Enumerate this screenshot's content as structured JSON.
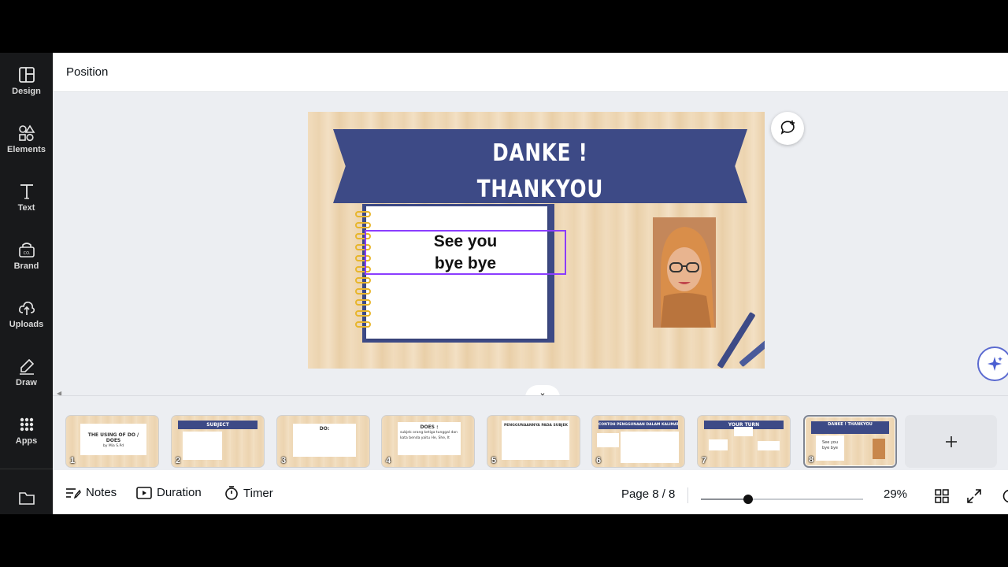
{
  "sidebar": {
    "items": [
      {
        "label": "Design",
        "icon": "layout-icon"
      },
      {
        "label": "Elements",
        "icon": "shapes-icon"
      },
      {
        "label": "Text",
        "icon": "text-icon"
      },
      {
        "label": "Brand",
        "icon": "brand-icon"
      },
      {
        "label": "Uploads",
        "icon": "upload-cloud-icon"
      },
      {
        "label": "Draw",
        "icon": "draw-icon"
      },
      {
        "label": "Apps",
        "icon": "apps-grid-icon"
      }
    ],
    "folder_icon": "folder-icon"
  },
  "topbar": {
    "title": "Position"
  },
  "slide": {
    "banner_line1": "DANKE !",
    "banner_line2": "THANKYOU",
    "text_line1": "See you",
    "text_line2": "bye bye"
  },
  "filmstrip": {
    "pages": [
      {
        "num": "1",
        "title": "THE USING OF DO / DOES",
        "body": "by Mia S.Pd"
      },
      {
        "num": "2",
        "title": "SUBJECT",
        "body": ""
      },
      {
        "num": "3",
        "title": "DO:",
        "body": ""
      },
      {
        "num": "4",
        "title": "DOES :",
        "body": "subjek orang ketiga tunggal dan kata benda yaitu He, She, It"
      },
      {
        "num": "5",
        "title": "PENGGUNAANNYA PADA SUBJEK",
        "body": ""
      },
      {
        "num": "6",
        "title": "CONTOH PENGGUNAAN DALAM KALIMAT",
        "body": ""
      },
      {
        "num": "7",
        "title": "YOUR TURN",
        "body": ""
      },
      {
        "num": "8",
        "title": "DANKE ! THANKYOU",
        "body": "See you bye bye"
      }
    ],
    "active_page": 8
  },
  "bottombar": {
    "notes_label": "Notes",
    "duration_label": "Duration",
    "timer_label": "Timer",
    "page_info": "Page 8 / 8",
    "zoom_label": "29%",
    "zoom_fraction": 0.29
  },
  "colors": {
    "banner": "#3d4a86",
    "selection": "#8b3dff",
    "sidebar_bg": "#18191b",
    "spiral": "#e8b62c"
  }
}
